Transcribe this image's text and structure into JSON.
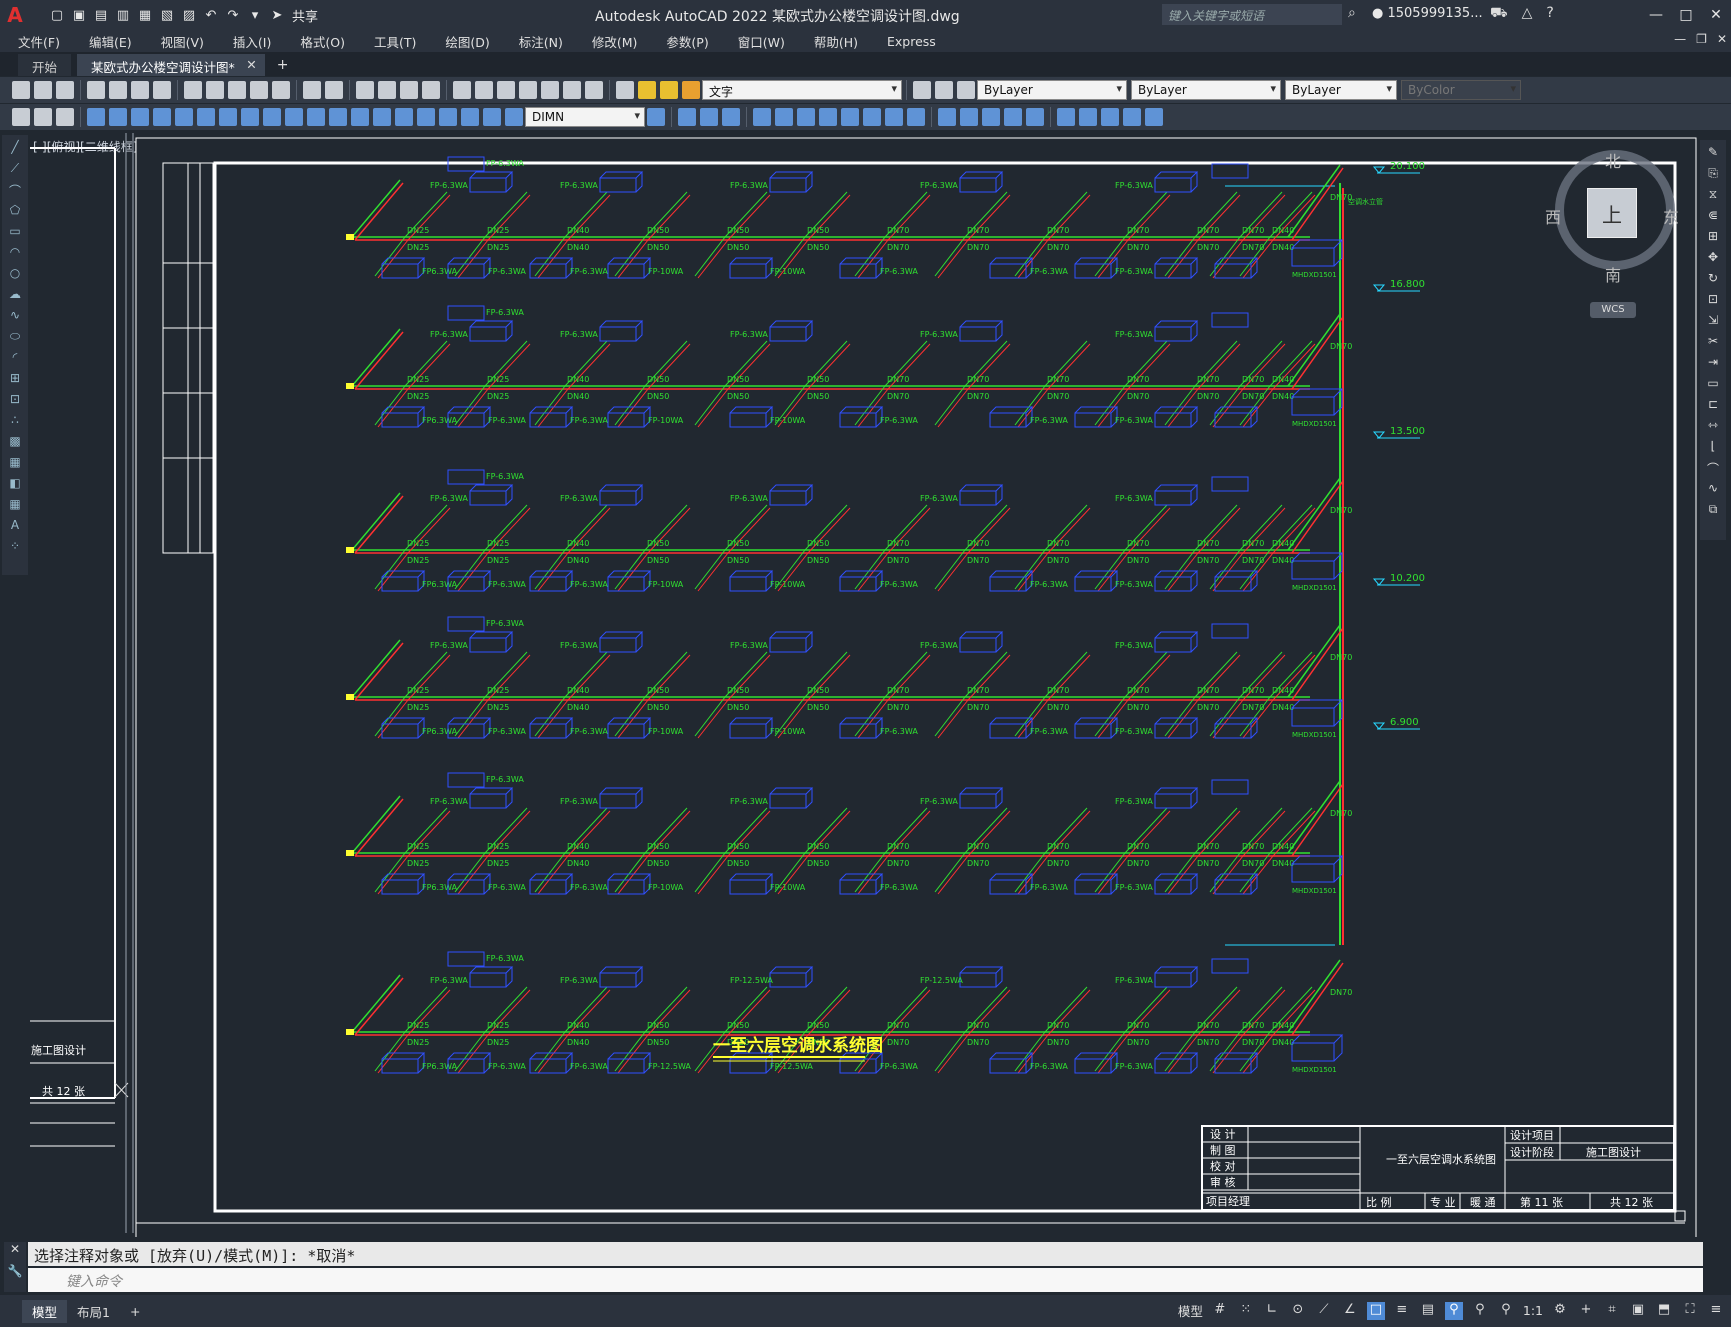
{
  "app": {
    "logo": "A",
    "share": "共享",
    "title": "Autodesk AutoCAD 2022    某欧式办公楼空调设计图.dwg",
    "search_placeholder": "键入关键字或短语",
    "user": "1505999135..."
  },
  "menu": [
    "文件(F)",
    "编辑(E)",
    "视图(V)",
    "插入(I)",
    "格式(O)",
    "工具(T)",
    "绘图(D)",
    "标注(N)",
    "修改(M)",
    "参数(P)",
    "窗口(W)",
    "帮助(H)",
    "Express"
  ],
  "tabs": {
    "start": "开始",
    "active": "某欧式办公楼空调设计图*"
  },
  "toolbar": {
    "text_style": "文字",
    "layer": "ByLayer",
    "linetype": "ByLayer",
    "lineweight": "ByLayer",
    "color": "ByColor",
    "dim_style": "DIMN"
  },
  "viewport": {
    "label": "[-][俯视][二维线框]"
  },
  "viewcube": {
    "north": "北",
    "south": "南",
    "west": "西",
    "east": "东",
    "face": "上",
    "wcs": "WCS"
  },
  "drawing": {
    "title": "一至六层空调水系统图",
    "elevations": [
      "20.100",
      "16.800",
      "13.500",
      "10.200",
      "6.900"
    ],
    "riser_labels": [
      "DN70",
      "DN70",
      "DN70",
      "DN70",
      "DN70",
      "DN70"
    ],
    "floor_labels": {
      "branch": [
        "DN25",
        "DN25",
        "DN40",
        "DN50",
        "DN50",
        "DN50",
        "DN70",
        "DN70",
        "DN70",
        "DN70",
        "DN70",
        "DN70",
        "DN40"
      ],
      "fcu_top": [
        "FP-6.3WA",
        "FP-6.3WA",
        "FP-6.3WA",
        "FP-6.3WA",
        "FP-6.3WA",
        "FP-6.3WA"
      ],
      "fcu_bottom": [
        "FP6.3WA",
        "FP-6.3WA",
        "FP-6.3WA",
        "FP-10WA",
        "FP-10WA",
        "FP-6.3WA",
        "FP-6.3WA",
        "FP-6.3WA"
      ],
      "fcu_top_f1": "FP-12.5WA",
      "fcu_bottom_f1": "FP-12.5WA",
      "ahu": "MHDXD1501"
    },
    "titleblock": {
      "left_rows": [
        "设 计",
        "制 图",
        "校 对",
        "审 核",
        "项目经理"
      ],
      "drawing_name": "一至六层空调水系统图",
      "project": "设计项目",
      "stage_label": "设计阶段",
      "stage": "施工图设计",
      "scale": "比 例",
      "discipline_label": "专 业",
      "discipline": "暖 通",
      "sheet": "第 11 张",
      "total": "共 12 张"
    },
    "left_sheet": {
      "stage": "施工图设计",
      "total": "共 12 张"
    }
  },
  "command": {
    "history": "选择注释对象或 [放弃(U)/模式(M)]: *取消*",
    "placeholder": "键入命令"
  },
  "status": {
    "model_tab": "模型",
    "layout_tab": "布局1",
    "model": "模型",
    "scale": "1:1"
  }
}
